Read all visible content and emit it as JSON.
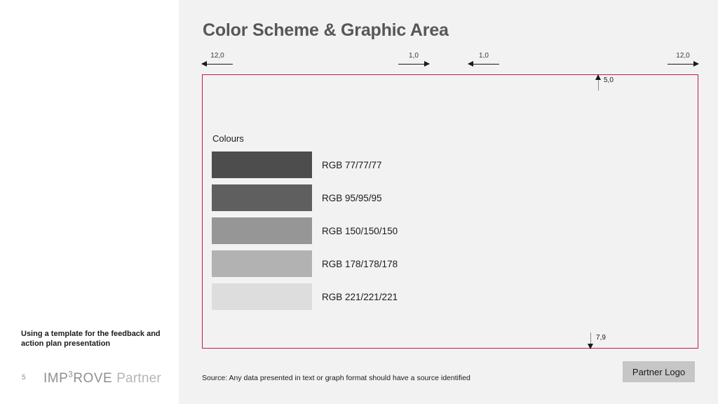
{
  "slide": {
    "title": "Color Scheme & Graphic Area",
    "background_color": "#f2f2f2",
    "page_number": "5"
  },
  "graphic_area": {
    "border_color": "#c2185b",
    "dimensions": {
      "top_left": {
        "value": "12,0",
        "direction": "left"
      },
      "top_mid_left": {
        "value": "1,0",
        "direction": "right"
      },
      "top_mid_right": {
        "value": "1,0",
        "direction": "left"
      },
      "top_right": {
        "value": "12,0",
        "direction": "right"
      },
      "inner_top": {
        "value": "5,0",
        "direction": "up"
      },
      "inner_bottom": {
        "value": "7,9",
        "direction": "down"
      }
    }
  },
  "colours": {
    "heading": "Colours",
    "swatches": [
      {
        "label": "RGB 77/77/77",
        "hex": "#4d4d4d"
      },
      {
        "label": "RGB 95/95/95",
        "hex": "#5f5f5f"
      },
      {
        "label": "RGB 150/150/150",
        "hex": "#969696"
      },
      {
        "label": "RGB 178/178/178",
        "hex": "#b2b2b2"
      },
      {
        "label": "RGB 221/221/221",
        "hex": "#dddddd"
      }
    ]
  },
  "footer": {
    "note": "Using a template for the feedback and action plan presentation",
    "brand_mark": "IMP",
    "brand_superscript": "3",
    "brand_mark_tail": "ROVE",
    "brand_sub": "Partner",
    "source": "Source: Any data presented in text or graph format should have a source identified",
    "partner_logo_placeholder": "Partner Logo"
  }
}
